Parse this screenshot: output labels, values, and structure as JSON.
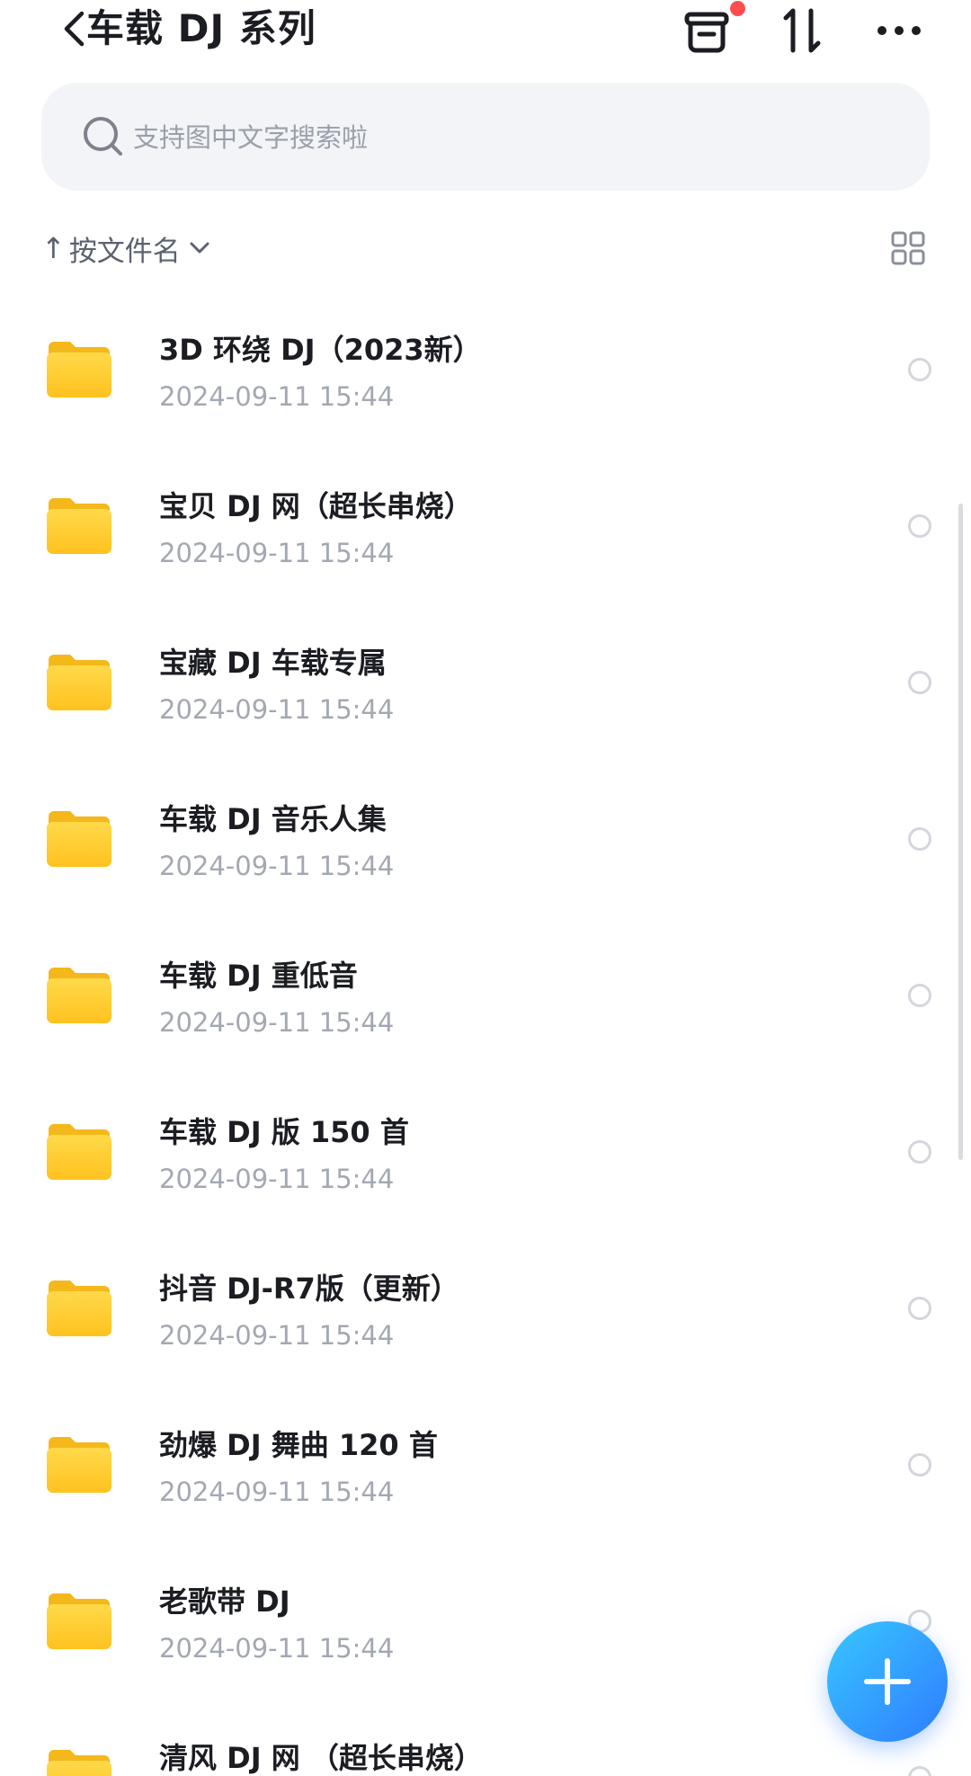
{
  "header": {
    "title": "车载 DJ 系列",
    "back_icon": "chevron-left-icon",
    "actions": [
      "bag-icon",
      "sort-toggle-icon",
      "more-icon"
    ],
    "notification_dot_color": "#ff4d4f"
  },
  "search": {
    "placeholder": "支持图中文字搜索啦",
    "value": ""
  },
  "sort": {
    "label": "按文件名",
    "direction_arrow": "↑"
  },
  "list": {
    "items": [
      {
        "name": "3D 环绕 DJ（2023新）",
        "date": "2024-09-11 15:44"
      },
      {
        "name": "宝贝 DJ 网（超长串烧）",
        "date": "2024-09-11 15:44"
      },
      {
        "name": "宝藏 DJ 车载专属",
        "date": "2024-09-11 15:44"
      },
      {
        "name": "车载 DJ 音乐人集",
        "date": "2024-09-11 15:44"
      },
      {
        "name": "车载 DJ 重低音",
        "date": "2024-09-11 15:44"
      },
      {
        "name": "车载 DJ 版 150 首",
        "date": "2024-09-11 15:44"
      },
      {
        "name": "抖音 DJ-R7版（更新）",
        "date": "2024-09-11 15:44"
      },
      {
        "name": "劲爆 DJ 舞曲 120 首",
        "date": "2024-09-11 15:44"
      },
      {
        "name": "老歌带 DJ",
        "date": "2024-09-11 15:44"
      },
      {
        "name": "清风 DJ 网 （超长串烧）",
        "date": ""
      }
    ]
  },
  "colors": {
    "folder_yellow": "#ffc933",
    "fab_gradient_start": "#37c7ff",
    "fab_gradient_end": "#2f7cff",
    "secondary_text": "#a3a8b2"
  }
}
